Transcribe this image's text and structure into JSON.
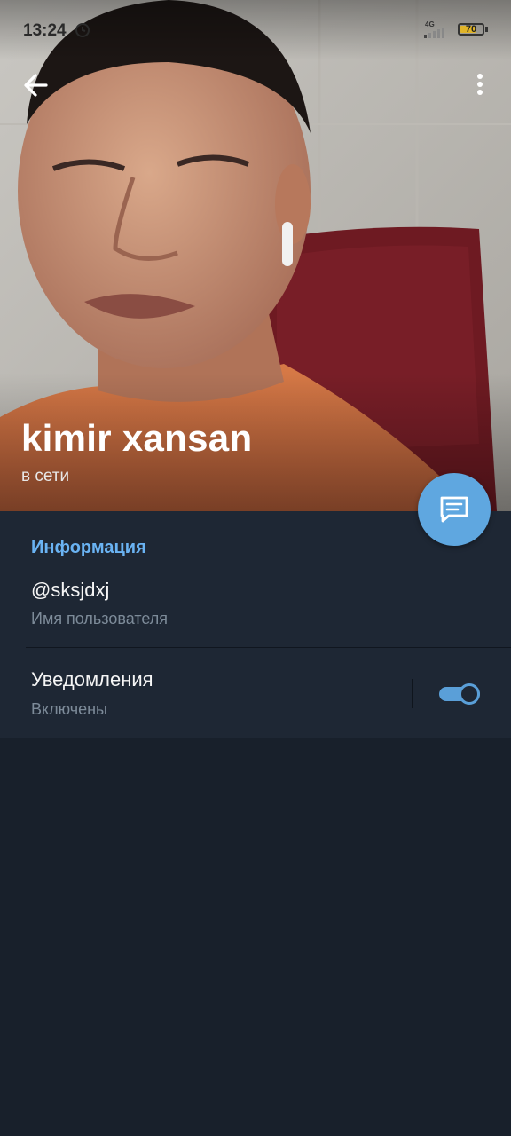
{
  "status_bar": {
    "time": "13:24",
    "network": "4G",
    "battery": "70",
    "battery_level": 0.7,
    "icons": [
      "alarm-icon",
      "signal-icon",
      "battery-icon"
    ]
  },
  "header": {
    "back_icon": "arrow-left-icon",
    "menu_icon": "more-vertical-icon",
    "name": "kimir xansan",
    "status": "в сети"
  },
  "info": {
    "section_title": "Информация",
    "username": "@sksjdxj",
    "username_label": "Имя пользователя",
    "notifications_title": "Уведомления",
    "notifications_status": "Включены",
    "notifications_enabled": true
  },
  "fab": {
    "icon": "message-icon"
  },
  "colors": {
    "accent": "#6ab3f3",
    "toggle": "#5a9fd8",
    "fab": "#5fa7e0",
    "panel": "#1e2734",
    "background": "#18202b"
  }
}
